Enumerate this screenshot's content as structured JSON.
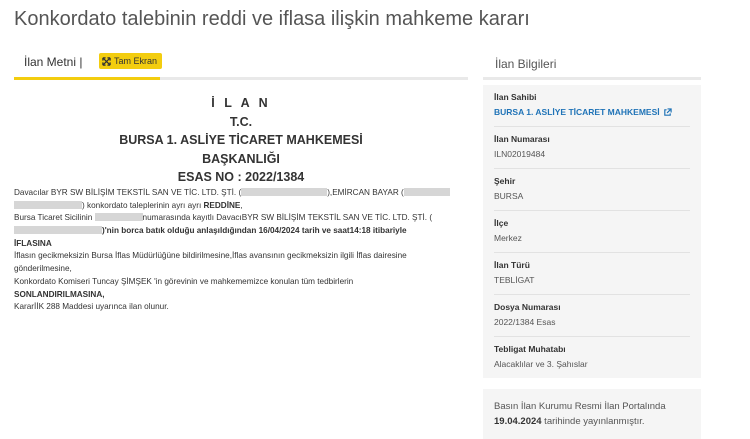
{
  "page": {
    "title": "Konkordato talebinin reddi ve iflasa ilişkin mahkeme kararı"
  },
  "tabs": {
    "text_label": "İlan Metni |",
    "fullscreen_label": "Tam Ekran"
  },
  "document": {
    "heading1": "İ L A N",
    "heading2": "T.C.",
    "heading3": "BURSA 1. ASLİYE TİCARET MAHKEMESİ",
    "heading4": "BAŞKANLIĞI",
    "heading5": "ESAS NO : 2022/1384",
    "line1a": "Davacılar BYR SW BİLİŞİM TEKSTİL SAN VE TİC. LTD. ŞTİ. (",
    "line1b": "),EMİRCAN BAYAR (",
    "line2a": "",
    "line2b": ") konkordato taleplerinin ayrı ayrı ",
    "line2c": "REDDİNE",
    "line2d": ",",
    "line3a": "Bursa Ticaret Sicilinin ",
    "line3b": "numarasında kayıtlı DavacıBYR SW BİLİŞİM TEKSTİL SAN VE TİC. LTD. ŞTİ. (",
    "line4a": "",
    "line4b": ")'nin borca batık olduğu anlaşıldığından 16/04/2024 tarih ve saat14:18 itibariyle",
    "line5": "İFLASINA",
    "line6": "İflasın gecikmeksizin Bursa İflas Müdürlüğüne bildirilmesine,İflas avansının gecikmeksizin ilgili İflas dairesine",
    "line7": "gönderilmesine,",
    "line8": "Konkordato Komiseri Tuncay ŞİMŞEK 'in görevinin ve mahkememizce konulan tüm tedbirlerin",
    "line9": "SONLANDIRILMASINA,",
    "line10": "KararİİK 288 Maddesi uyarınca ilan olunur."
  },
  "info": {
    "header": "İlan Bilgileri",
    "fields": [
      {
        "label": "İlan Sahibi",
        "value": "BURSA 1. ASLİYE TİCARET MAHKEMESİ"
      },
      {
        "label": "İlan Numarası",
        "value": "ILN02019484"
      },
      {
        "label": "Şehir",
        "value": "BURSA"
      },
      {
        "label": "İlçe",
        "value": "Merkez"
      },
      {
        "label": "İlan Türü",
        "value": "TEBLİGAT"
      },
      {
        "label": "Dosya Numarası",
        "value": "2022/1384 Esas"
      },
      {
        "label": "Tebligat Muhatabı",
        "value": "Alacaklılar ve 3. Şahıslar"
      }
    ],
    "portal_prefix": "Basın İlan Kurumu Resmi İlan Portalında",
    "portal_date": "19.04.2024",
    "portal_suffix": " tarihinde yayınlanmıştır."
  },
  "colors": {
    "accent": "#f3cd0f",
    "link": "#1f73b7",
    "panel": "#f5f5f5"
  },
  "icons": {
    "fullscreen": "expand-arrows-icon",
    "external_link": "external-link-icon"
  }
}
